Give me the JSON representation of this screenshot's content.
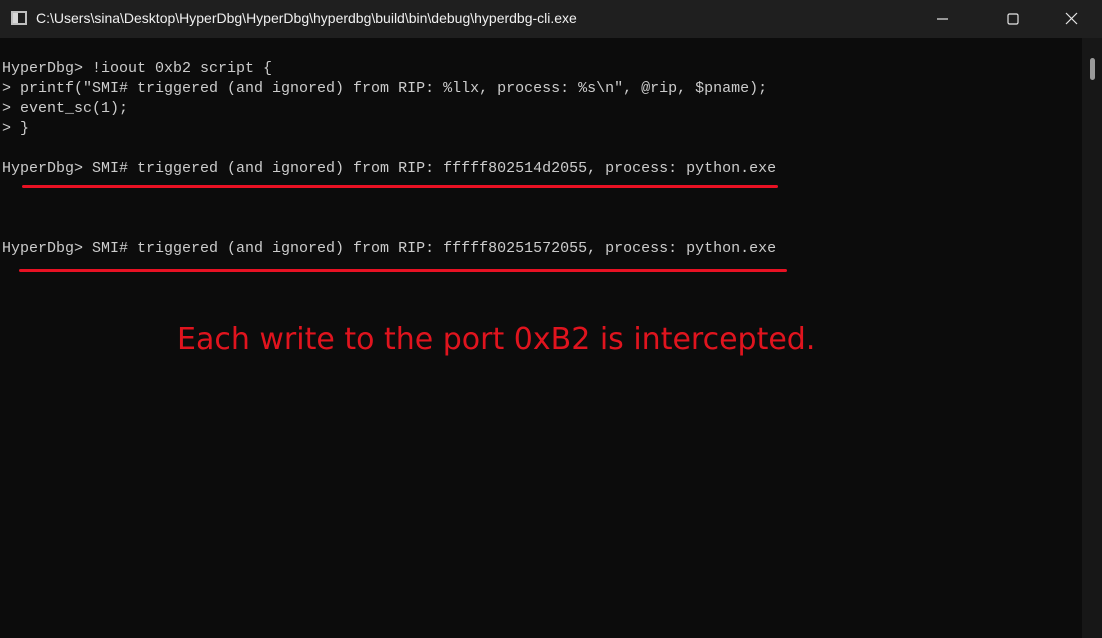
{
  "window": {
    "title": "C:\\Users\\sina\\Desktop\\HyperDbg\\HyperDbg\\hyperdbg\\build\\bin\\debug\\hyperdbg-cli.exe",
    "icons": {
      "app": "console-app-icon",
      "minimize": "minimize-icon",
      "maximize": "maximize-icon",
      "close": "close-icon"
    }
  },
  "console": {
    "lines": [
      "HyperDbg> !ioout 0xb2 script {",
      "> printf(\"SMI# triggered (and ignored) from RIP: %llx, process: %s\\n\", @rip, $pname);",
      "> event_sc(1);",
      "> }",
      "",
      "HyperDbg> SMI# triggered (and ignored) from RIP: fffff802514d2055, process: python.exe",
      "",
      "",
      "",
      "HyperDbg> SMI# triggered (and ignored) from RIP: fffff80251572055, process: python.exe"
    ],
    "text_color": "#cccccc",
    "background": "#0c0c0c"
  },
  "annotation": {
    "text": "Each write to the port 0xB2 is intercepted.",
    "color": "#e0141e"
  },
  "highlight_color": "#e81123"
}
